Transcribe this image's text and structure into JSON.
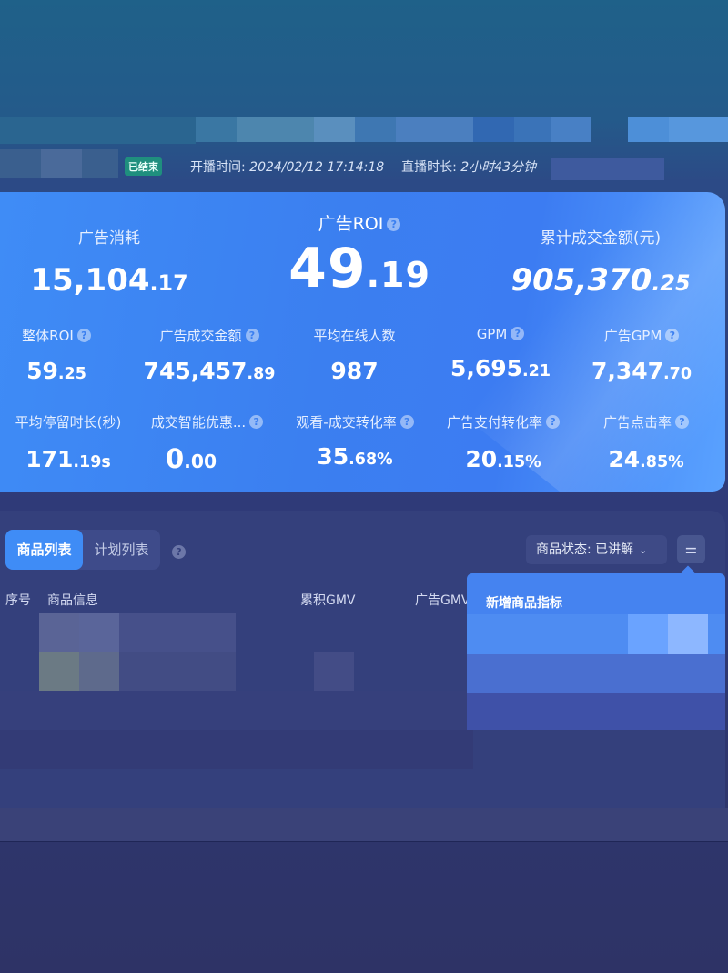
{
  "header": {
    "status_badge": "已结束",
    "start_label": "开播时间:",
    "start_value": "2024/02/12 17:14:18",
    "duration_label": "直播时长:",
    "duration_value": "2小时43分钟"
  },
  "metrics": {
    "ad_spend": {
      "label": "广告消耗",
      "int": "15,104",
      "dec": ".17"
    },
    "ad_roi": {
      "label": "广告ROI",
      "int": "49",
      "dec": ".19"
    },
    "total_gmv": {
      "label": "累计成交金额(元)",
      "int": "905,370",
      "dec": ".25"
    },
    "row2": [
      {
        "label": "整体ROI",
        "int": "59",
        "dec": ".25",
        "help": true
      },
      {
        "label": "广告成交金额",
        "int": "745,457",
        "dec": ".89",
        "help": true
      },
      {
        "label": "平均在线人数",
        "int": "987",
        "dec": "",
        "help": false
      },
      {
        "label": "GPM",
        "int": "5,695",
        "dec": ".21",
        "help": true
      },
      {
        "label": "广告GPM",
        "int": "7,347",
        "dec": ".70",
        "help": true
      }
    ],
    "row3": [
      {
        "label": "平均停留时长(秒)",
        "int": "171",
        "dec": ".19s",
        "help": false
      },
      {
        "label": "成交智能优惠...",
        "int": "0",
        "dec": ".00",
        "help": true
      },
      {
        "label": "观看-成交转化率",
        "int": "35",
        "dec": ".68%",
        "help": true
      },
      {
        "label": "广告支付转化率",
        "int": "20",
        "dec": ".15%",
        "help": true
      },
      {
        "label": "广告点击率",
        "int": "24",
        "dec": ".85%",
        "help": true
      }
    ]
  },
  "list": {
    "tabs": [
      "商品列表",
      "计划列表"
    ],
    "status_filter": "商品状态: 已讲解",
    "columns": [
      "序号",
      "商品信息",
      "累积GMV",
      "广告GMV"
    ],
    "dropdown_title": "新增商品指标"
  },
  "icons": {
    "help": "?",
    "chevron": "⌄",
    "filter": "⚌"
  }
}
